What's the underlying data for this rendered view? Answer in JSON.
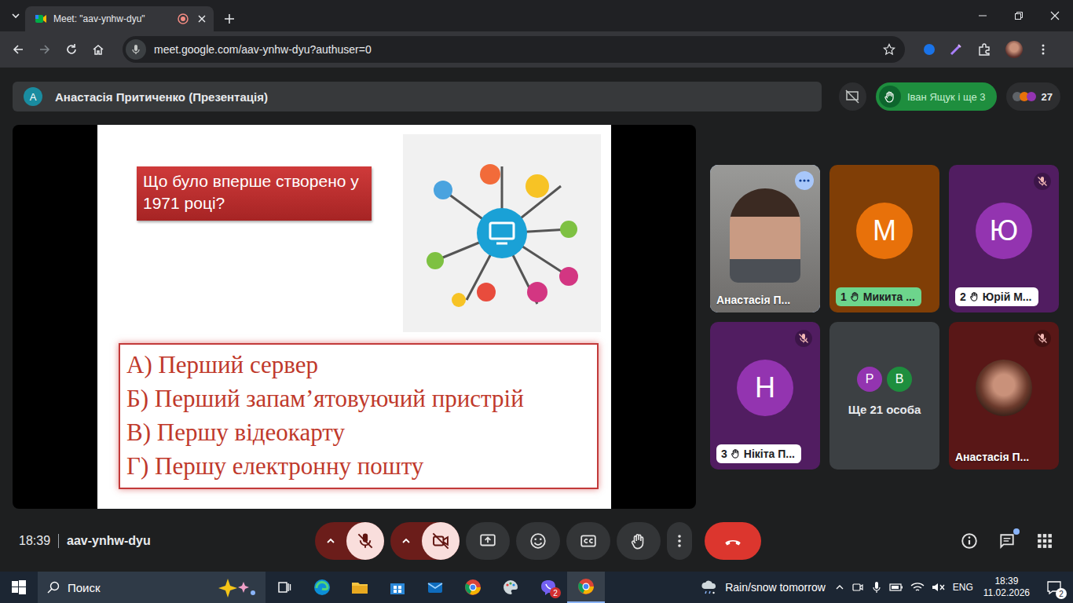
{
  "browser": {
    "tab_title": "Meet: \"aav-ynhw-dyu\"",
    "recording": true,
    "url": "meet.google.com/aav-ynhw-dyu?authuser=0"
  },
  "meet": {
    "presenter": {
      "avatar": "A",
      "label": "Анастасія Притиченко (Презентація)"
    },
    "raised_hands": "Іван Ящук і ще 3",
    "participants_count": "27",
    "slide": {
      "question": "Що було вперше створено у 1971 році?",
      "answers": [
        "А) Перший сервер",
        "Б) Перший запам’ятовуючий пристрій",
        "В) Першу відеокарту",
        "Г) Першу електронну пошту"
      ]
    },
    "tiles": [
      {
        "kind": "camera",
        "name": "Анастасія П...",
        "letter": "",
        "color": "#8a8a86",
        "hand": "",
        "hand_first": false,
        "muted": false,
        "speaking": true,
        "avatars": []
      },
      {
        "kind": "avatar",
        "name": "Микита ...",
        "letter": "М",
        "color": "#e8710a",
        "hand": "1",
        "hand_first": true,
        "muted": false,
        "speaking": false,
        "avatars": []
      },
      {
        "kind": "avatar",
        "name": "Юрій М...",
        "letter": "Ю",
        "color": "#9334b0",
        "hand": "2",
        "hand_first": false,
        "muted": true,
        "speaking": false,
        "avatars": []
      },
      {
        "kind": "avatar",
        "name": "Нікіта П...",
        "letter": "Н",
        "color": "#9334b0",
        "hand": "3",
        "hand_first": false,
        "muted": true,
        "speaking": false,
        "avatars": []
      },
      {
        "kind": "group",
        "name": "Ще 21 особа",
        "letter": "",
        "color": "#3c4043",
        "hand": "",
        "hand_first": false,
        "muted": false,
        "speaking": false,
        "avatars": [
          {
            "letter": "Р",
            "color": "#9334b0"
          },
          {
            "letter": "В",
            "color": "#1e8e3e"
          }
        ]
      },
      {
        "kind": "photo",
        "name": "Анастасія П...",
        "letter": "",
        "color": "#a12a2a",
        "hand": "",
        "hand_first": false,
        "muted": true,
        "speaking": false,
        "avatars": []
      }
    ],
    "footer": {
      "time": "18:39",
      "code": "aav-ynhw-dyu",
      "mic_muted": true,
      "camera_off": true,
      "chat_unread": true
    }
  },
  "taskbar": {
    "search": "Поиск",
    "app_badge": "2",
    "weather": "Rain/snow tomorrow",
    "lang": "ENG",
    "time": "18:39",
    "date": "11.02.2026",
    "notifications": "2"
  }
}
